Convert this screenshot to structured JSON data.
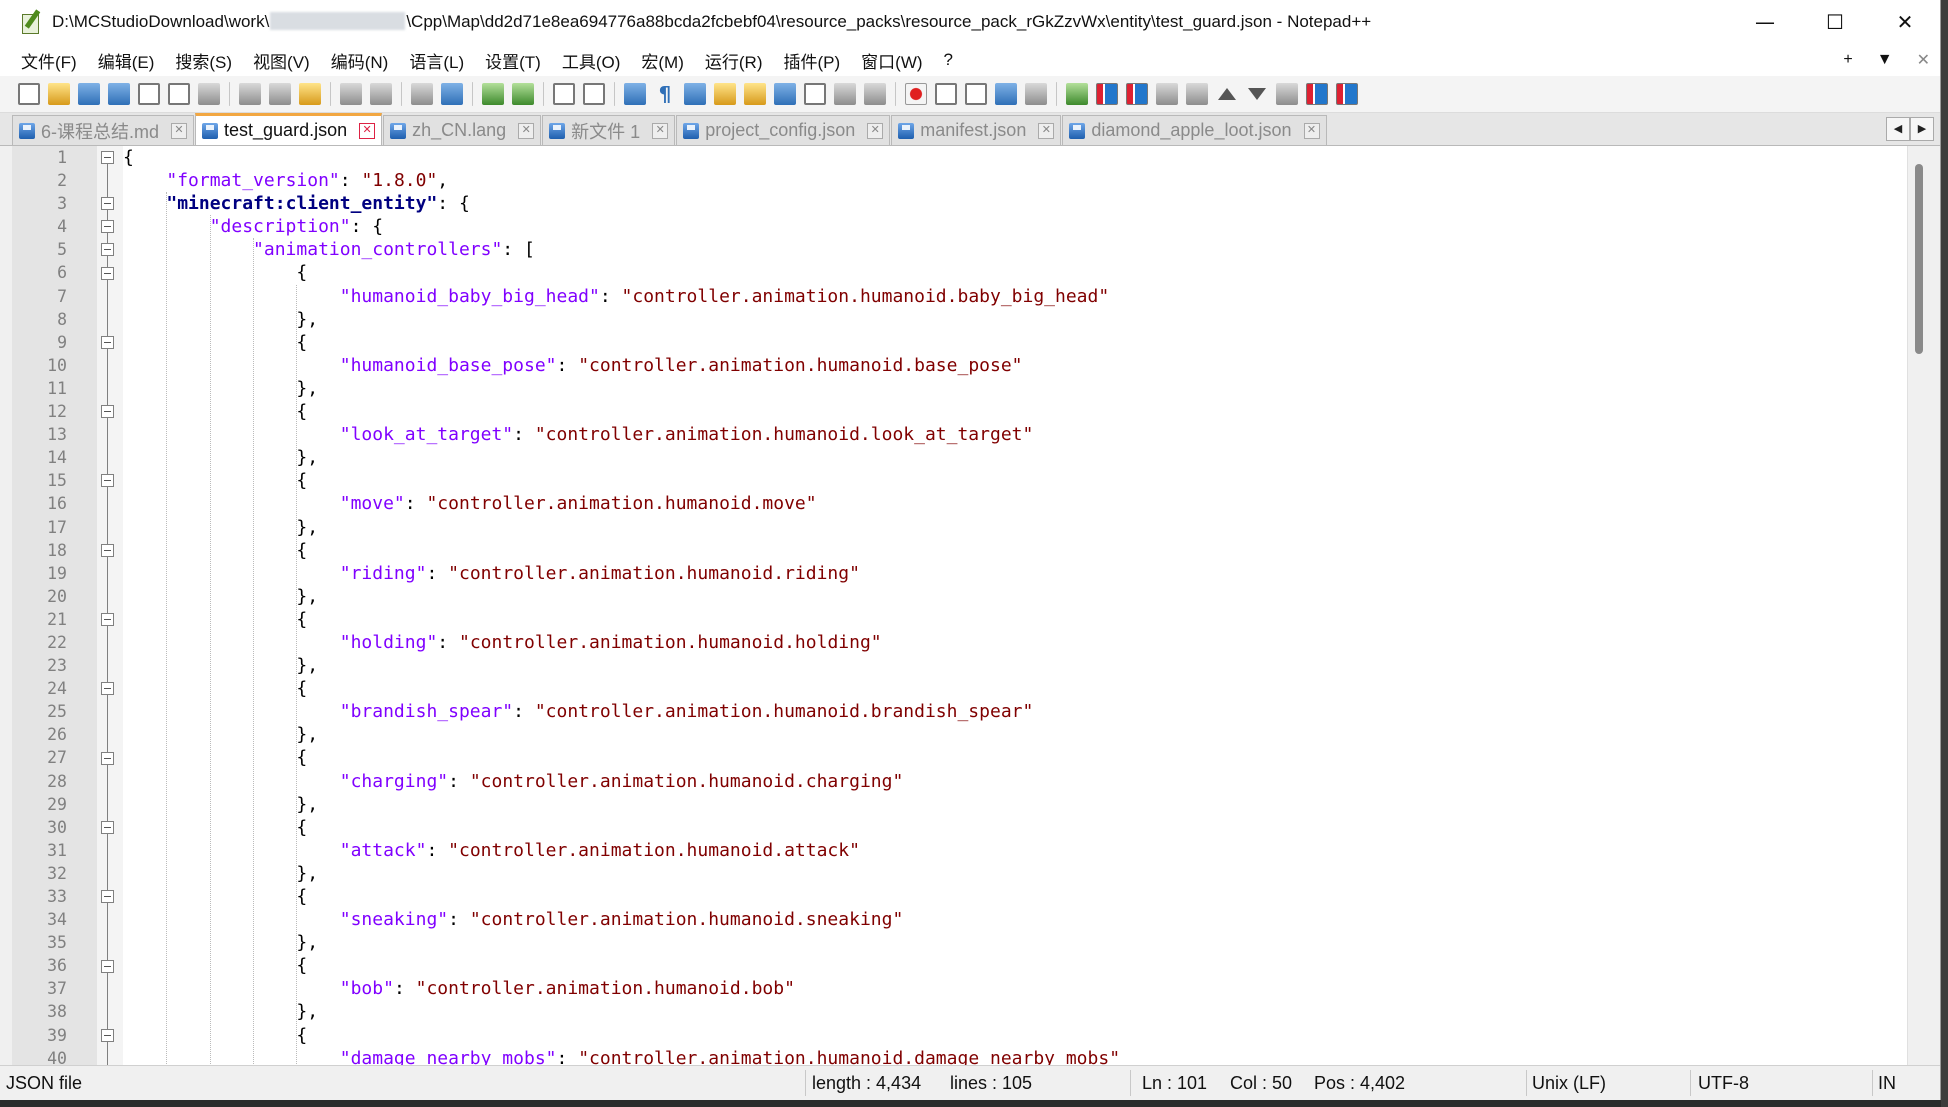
{
  "window": {
    "title_prefix": "D:\\MCStudioDownload\\work\\",
    "title_suffix": "\\Cpp\\Map\\dd2d71e8ea694776a88bcda2fcbebf04\\resource_packs\\resource_pack_rGkZzvWx\\entity\\test_guard.json - Notepad++",
    "min_icon": "—",
    "max_icon": "☐",
    "close_icon": "✕"
  },
  "menu": {
    "items": [
      "文件(F)",
      "编辑(E)",
      "搜索(S)",
      "视图(V)",
      "编码(N)",
      "语言(L)",
      "设置(T)",
      "工具(O)",
      "宏(M)",
      "运行(R)",
      "插件(P)",
      "窗口(W)",
      "?"
    ],
    "right": [
      "+",
      "▼",
      "✕"
    ]
  },
  "tabs": [
    {
      "label": "6-课程总结.md",
      "active": false
    },
    {
      "label": "test_guard.json",
      "active": true
    },
    {
      "label": "zh_CN.lang",
      "active": false
    },
    {
      "label": "新文件 1",
      "active": false
    },
    {
      "label": "project_config.json",
      "active": false
    },
    {
      "label": "manifest.json",
      "active": false
    },
    {
      "label": "diamond_apple_loot.json",
      "active": false
    }
  ],
  "tab_scroll": {
    "left": "◀",
    "right": "▶"
  },
  "editor": {
    "line_numbers": [
      "1",
      "2",
      "3",
      "4",
      "5",
      "6",
      "7",
      "8",
      "9",
      "10",
      "11",
      "12",
      "13",
      "14",
      "15",
      "16",
      "17",
      "18",
      "19",
      "20",
      "21",
      "22",
      "23",
      "24",
      "25",
      "26",
      "27",
      "28",
      "29",
      "30",
      "31",
      "32",
      "33",
      "34",
      "35",
      "36",
      "37",
      "38",
      "39",
      "40"
    ],
    "lines": [
      [
        {
          "t": "p",
          "v": "{"
        }
      ],
      [
        {
          "t": "p",
          "v": "    "
        },
        {
          "t": "k",
          "v": "\"format_version\""
        },
        {
          "t": "p",
          "v": ": "
        },
        {
          "t": "s",
          "v": "\"1.8.0\""
        },
        {
          "t": "p",
          "v": ","
        }
      ],
      [
        {
          "t": "p",
          "v": "    "
        },
        {
          "t": "kb",
          "v": "\"minecraft:client_entity\""
        },
        {
          "t": "p",
          "v": ": {"
        }
      ],
      [
        {
          "t": "p",
          "v": "        "
        },
        {
          "t": "k",
          "v": "\"description\""
        },
        {
          "t": "p",
          "v": ": {"
        }
      ],
      [
        {
          "t": "p",
          "v": "            "
        },
        {
          "t": "k",
          "v": "\"animation_controllers\""
        },
        {
          "t": "p",
          "v": ": ["
        }
      ],
      [
        {
          "t": "p",
          "v": "                {"
        }
      ],
      [
        {
          "t": "p",
          "v": "                    "
        },
        {
          "t": "k",
          "v": "\"humanoid_baby_big_head\""
        },
        {
          "t": "p",
          "v": ": "
        },
        {
          "t": "s",
          "v": "\"controller.animation.humanoid.baby_big_head\""
        }
      ],
      [
        {
          "t": "p",
          "v": "                },"
        }
      ],
      [
        {
          "t": "p",
          "v": "                {"
        }
      ],
      [
        {
          "t": "p",
          "v": "                    "
        },
        {
          "t": "k",
          "v": "\"humanoid_base_pose\""
        },
        {
          "t": "p",
          "v": ": "
        },
        {
          "t": "s",
          "v": "\"controller.animation.humanoid.base_pose\""
        }
      ],
      [
        {
          "t": "p",
          "v": "                },"
        }
      ],
      [
        {
          "t": "p",
          "v": "                {"
        }
      ],
      [
        {
          "t": "p",
          "v": "                    "
        },
        {
          "t": "k",
          "v": "\"look_at_target\""
        },
        {
          "t": "p",
          "v": ": "
        },
        {
          "t": "s",
          "v": "\"controller.animation.humanoid.look_at_target\""
        }
      ],
      [
        {
          "t": "p",
          "v": "                },"
        }
      ],
      [
        {
          "t": "p",
          "v": "                {"
        }
      ],
      [
        {
          "t": "p",
          "v": "                    "
        },
        {
          "t": "k",
          "v": "\"move\""
        },
        {
          "t": "p",
          "v": ": "
        },
        {
          "t": "s",
          "v": "\"controller.animation.humanoid.move\""
        }
      ],
      [
        {
          "t": "p",
          "v": "                },"
        }
      ],
      [
        {
          "t": "p",
          "v": "                {"
        }
      ],
      [
        {
          "t": "p",
          "v": "                    "
        },
        {
          "t": "k",
          "v": "\"riding\""
        },
        {
          "t": "p",
          "v": ": "
        },
        {
          "t": "s",
          "v": "\"controller.animation.humanoid.riding\""
        }
      ],
      [
        {
          "t": "p",
          "v": "                },"
        }
      ],
      [
        {
          "t": "p",
          "v": "                {"
        }
      ],
      [
        {
          "t": "p",
          "v": "                    "
        },
        {
          "t": "k",
          "v": "\"holding\""
        },
        {
          "t": "p",
          "v": ": "
        },
        {
          "t": "s",
          "v": "\"controller.animation.humanoid.holding\""
        }
      ],
      [
        {
          "t": "p",
          "v": "                },"
        }
      ],
      [
        {
          "t": "p",
          "v": "                {"
        }
      ],
      [
        {
          "t": "p",
          "v": "                    "
        },
        {
          "t": "k",
          "v": "\"brandish_spear\""
        },
        {
          "t": "p",
          "v": ": "
        },
        {
          "t": "s",
          "v": "\"controller.animation.humanoid.brandish_spear\""
        }
      ],
      [
        {
          "t": "p",
          "v": "                },"
        }
      ],
      [
        {
          "t": "p",
          "v": "                {"
        }
      ],
      [
        {
          "t": "p",
          "v": "                    "
        },
        {
          "t": "k",
          "v": "\"charging\""
        },
        {
          "t": "p",
          "v": ": "
        },
        {
          "t": "s",
          "v": "\"controller.animation.humanoid.charging\""
        }
      ],
      [
        {
          "t": "p",
          "v": "                },"
        }
      ],
      [
        {
          "t": "p",
          "v": "                {"
        }
      ],
      [
        {
          "t": "p",
          "v": "                    "
        },
        {
          "t": "k",
          "v": "\"attack\""
        },
        {
          "t": "p",
          "v": ": "
        },
        {
          "t": "s",
          "v": "\"controller.animation.humanoid.attack\""
        }
      ],
      [
        {
          "t": "p",
          "v": "                },"
        }
      ],
      [
        {
          "t": "p",
          "v": "                {"
        }
      ],
      [
        {
          "t": "p",
          "v": "                    "
        },
        {
          "t": "k",
          "v": "\"sneaking\""
        },
        {
          "t": "p",
          "v": ": "
        },
        {
          "t": "s",
          "v": "\"controller.animation.humanoid.sneaking\""
        }
      ],
      [
        {
          "t": "p",
          "v": "                },"
        }
      ],
      [
        {
          "t": "p",
          "v": "                {"
        }
      ],
      [
        {
          "t": "p",
          "v": "                    "
        },
        {
          "t": "k",
          "v": "\"bob\""
        },
        {
          "t": "p",
          "v": ": "
        },
        {
          "t": "s",
          "v": "\"controller.animation.humanoid.bob\""
        }
      ],
      [
        {
          "t": "p",
          "v": "                },"
        }
      ],
      [
        {
          "t": "p",
          "v": "                {"
        }
      ],
      [
        {
          "t": "p",
          "v": "                    "
        },
        {
          "t": "k",
          "v": "\"damage_nearby_mobs\""
        },
        {
          "t": "p",
          "v": ": "
        },
        {
          "t": "s",
          "v": "\"controller.animation.humanoid.damage_nearby_mobs\""
        }
      ]
    ],
    "fold_marker_lines": [
      1,
      3,
      4,
      5,
      6,
      9,
      12,
      15,
      18,
      21,
      24,
      27,
      30,
      33,
      36,
      39
    ]
  },
  "status": {
    "file_type": "JSON file",
    "length": "length : 4,434",
    "lines": "lines : 105",
    "ln": "Ln : 101",
    "col": "Col : 50",
    "pos": "Pos : 4,402",
    "eol": "Unix (LF)",
    "encoding": "UTF-8",
    "mode": "IN"
  },
  "colors": {
    "key": "#8000ff",
    "key_bold": "#000080",
    "string": "#800000",
    "gutter_bg": "#e4e4e4",
    "active_tab_accent": "#f2a742"
  }
}
